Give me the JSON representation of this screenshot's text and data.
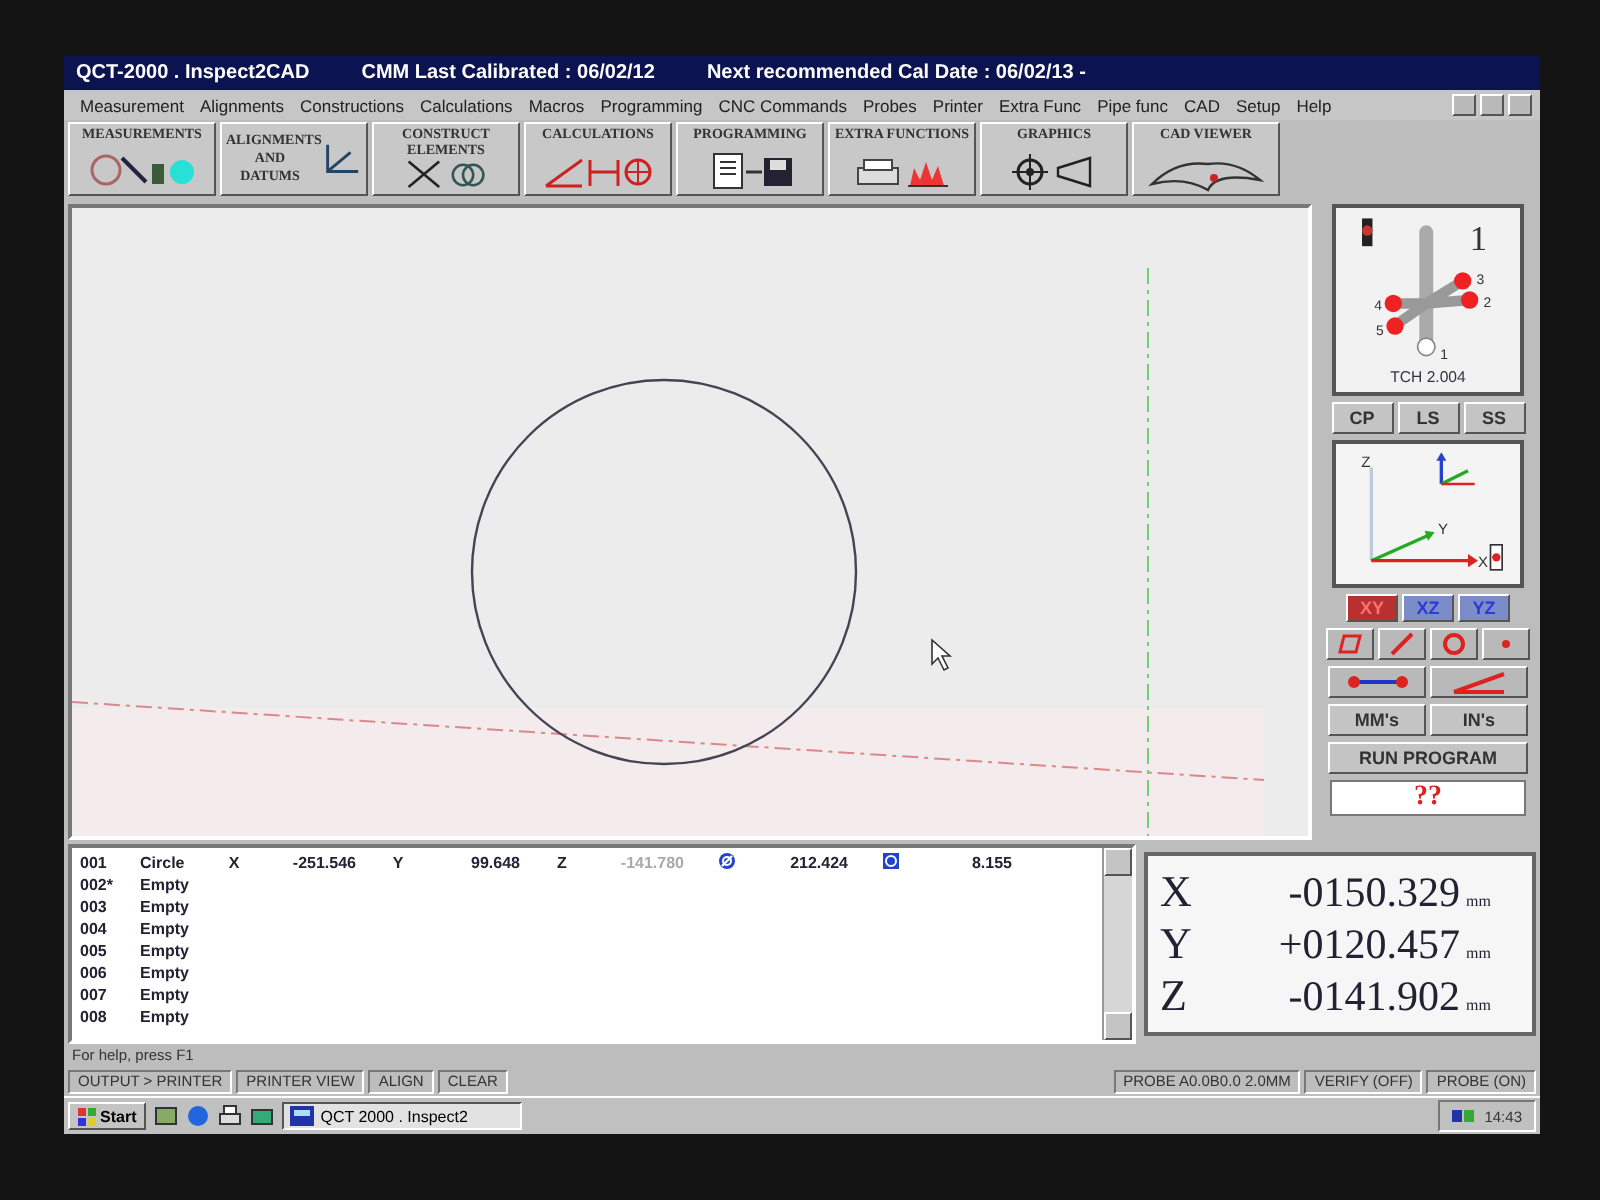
{
  "window": {
    "title": "QCT-2000 . Inspect2CAD",
    "calibration": "CMM  Last Calibrated : 06/02/12",
    "next_calibration": "Next recommended Cal Date : 06/02/13 -"
  },
  "menu": [
    "Measurement",
    "Alignments",
    "Constructions",
    "Calculations",
    "Macros",
    "Programming",
    "CNC Commands",
    "Probes",
    "Printer",
    "Extra Func",
    "Pipe func",
    "CAD",
    "Setup",
    "Help"
  ],
  "toolbar": [
    {
      "label": "MEASUREMENTS",
      "kind": "measure"
    },
    {
      "label": "ALIGNMENTS AND DATUMS",
      "kind": "axes"
    },
    {
      "label": "CONSTRUCT ELEMENTS",
      "kind": "construct"
    },
    {
      "label": "CALCULATIONS",
      "kind": "calc"
    },
    {
      "label": "PROGRAMMING",
      "kind": "program"
    },
    {
      "label": "EXTRA FUNCTIONS",
      "kind": "extra"
    },
    {
      "label": "GRAPHICS",
      "kind": "graphics"
    },
    {
      "label": "CAD VIEWER",
      "kind": "cad"
    }
  ],
  "probe": {
    "number": "1",
    "tips": [
      "1",
      "2",
      "3",
      "4",
      "5"
    ],
    "reading": "TCH 2.004"
  },
  "probe_buttons": [
    "CP",
    "LS",
    "SS"
  ],
  "axis_labels": [
    "Z",
    "Y",
    "X"
  ],
  "views": [
    {
      "label": "XY",
      "selected": true
    },
    {
      "label": "XZ",
      "selected": false
    },
    {
      "label": "YZ",
      "selected": false
    }
  ],
  "units": [
    "MM's",
    "IN's"
  ],
  "run_button": "RUN PROGRAM",
  "message": "??",
  "features": [
    {
      "number": "001",
      "name": "Circle",
      "values": [
        {
          "kind": "axis",
          "label": "X",
          "value": "-251.546",
          "dimmed": false
        },
        {
          "kind": "axis",
          "label": "Y",
          "value": "99.648",
          "dimmed": false
        },
        {
          "kind": "axis",
          "label": "Z",
          "value": "-141.780",
          "dimmed": true
        },
        {
          "kind": "diameter",
          "value": "212.424",
          "dimmed": false
        },
        {
          "kind": "form",
          "value": "8.155",
          "dimmed": false
        }
      ]
    },
    {
      "number": "002*",
      "name": "Empty"
    },
    {
      "number": "003",
      "name": "Empty"
    },
    {
      "number": "004",
      "name": "Empty"
    },
    {
      "number": "005",
      "name": "Empty"
    },
    {
      "number": "006",
      "name": "Empty"
    },
    {
      "number": "007",
      "name": "Empty"
    },
    {
      "number": "008",
      "name": "Empty"
    }
  ],
  "dro": [
    {
      "axis": "X",
      "value": "-0150.329",
      "unit": "mm"
    },
    {
      "axis": "Y",
      "value": "+0120.457",
      "unit": "mm"
    },
    {
      "axis": "Z",
      "value": "-0141.902",
      "unit": "mm"
    }
  ],
  "status_bar": {
    "help": "For help, press F1",
    "panels": [
      "OUTPUT > PRINTER",
      "PRINTER VIEW",
      "ALIGN",
      "CLEAR",
      "PROBE A0.0B0.0 2.0MM",
      "VERIFY (OFF)",
      "PROBE (ON)"
    ]
  },
  "taskbar": {
    "start": "Start",
    "tasks": [
      "QCT 2000 . Inspect2"
    ],
    "clock": "14:43"
  }
}
